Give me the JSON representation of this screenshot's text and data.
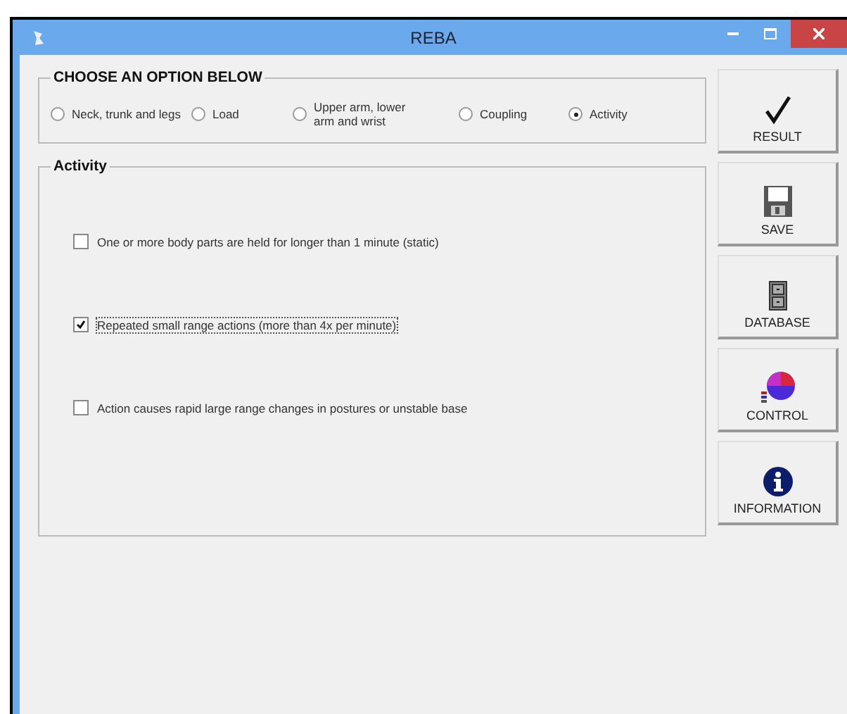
{
  "window": {
    "title": "REBA"
  },
  "options": {
    "title": "CHOOSE AN OPTION BELOW",
    "items": [
      {
        "label": "Neck, trunk and legs",
        "selected": false
      },
      {
        "label": "Load",
        "selected": false
      },
      {
        "label": "Upper arm, lower arm and wrist",
        "selected": false
      },
      {
        "label": "Coupling",
        "selected": false
      },
      {
        "label": "Activity",
        "selected": true
      }
    ]
  },
  "activity": {
    "title": "Activity",
    "items": [
      {
        "label": "One or more body parts are held for longer than 1 minute (static)",
        "checked": false
      },
      {
        "label": "Repeated small range actions (more than 4x per minute)",
        "checked": true
      },
      {
        "label": "Action causes rapid large range changes in postures or unstable base",
        "checked": false
      }
    ]
  },
  "buttons": [
    {
      "label": "RESULT",
      "kind": "check"
    },
    {
      "label": "SAVE",
      "kind": "disk"
    },
    {
      "label": "DATABASE",
      "kind": "cabinet"
    },
    {
      "label": "CONTROL",
      "kind": "pie"
    },
    {
      "label": "INFORMATION",
      "kind": "info"
    }
  ]
}
